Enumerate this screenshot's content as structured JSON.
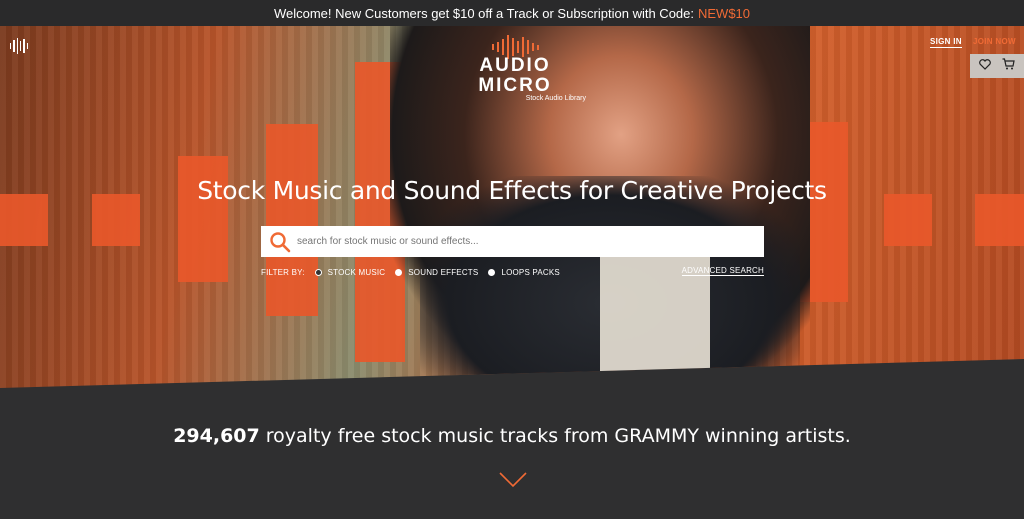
{
  "promo": {
    "text": "Welcome!  New Customers get $10 off a Track or Subscription with Code:",
    "code": "NEW$10"
  },
  "header": {
    "logo_text": "AUDIO MICRO",
    "logo_sub": "Stock Audio Library",
    "sign_in": "SIGN IN",
    "join_now": "JOIN NOW",
    "icons": [
      "menu-icon",
      "heart-icon",
      "cart-icon"
    ]
  },
  "hero": {
    "headline": "Stock Music and Sound Effects for Creative Projects",
    "search_placeholder": "search for stock music or sound effects...",
    "filter_label": "FILTER BY:",
    "filters": [
      {
        "label": "STOCK MUSIC",
        "selected": true
      },
      {
        "label": "SOUND EFFECTS",
        "selected": false
      },
      {
        "label": "LOOPS PACKS",
        "selected": false
      }
    ],
    "advanced_search": "ADVANCED SEARCH"
  },
  "stats": {
    "count": "294,607",
    "text": "royalty free stock music tracks from GRAMMY winning artists."
  },
  "colors": {
    "accent": "#f06a35",
    "dark_bg": "#2f2f30"
  }
}
